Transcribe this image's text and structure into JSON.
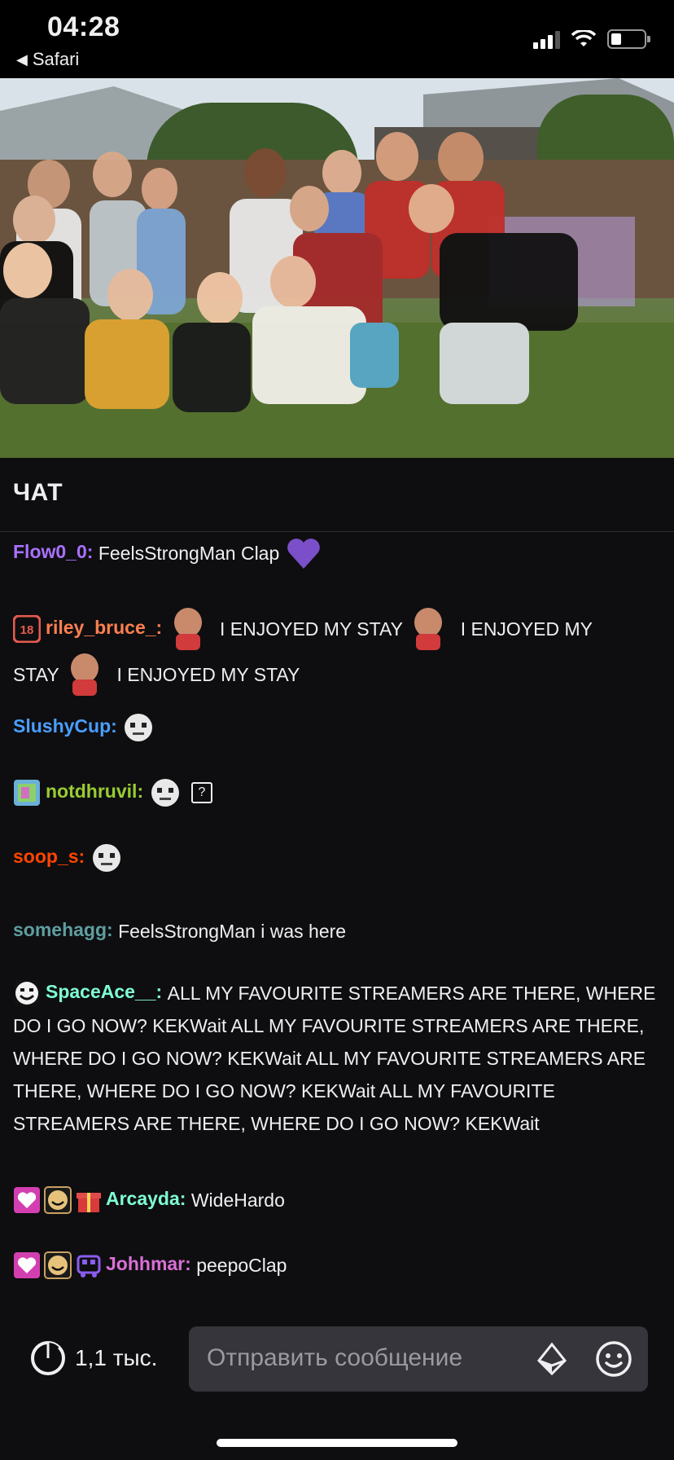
{
  "status_bar": {
    "time": "04:28",
    "back_app": "Safari"
  },
  "chat": {
    "title": "ЧАТ",
    "messages": [
      {
        "user": "Flow0_0",
        "user_color": "#a970ff",
        "text": "FeelsStrongMan Clap",
        "emotes": [
          "purple-heart-emote"
        ]
      },
      {
        "user": "riley_bruce_",
        "user_color": "#ff7f50",
        "badges": [
          "18-month-subscriber-badge"
        ],
        "parts": [
          "I ENJOYED MY STAY",
          "I ENJOYED MY",
          "STAY",
          "I ENJOYED MY STAY"
        ]
      },
      {
        "user": "SlushyCup",
        "user_color": "#4a9eff",
        "emotes": [
          "robot-face-emote"
        ]
      },
      {
        "user": "notdhruvil",
        "user_color": "#9acd32",
        "badges": [
          "pixel-art-badge"
        ],
        "emotes": [
          "robot-face-emote",
          "unknown-emote"
        ],
        "unknown_symbol": "?"
      },
      {
        "user": "soop_s",
        "user_color": "#ff4500",
        "emotes": [
          "robot-face-emote"
        ]
      },
      {
        "user": "somehagg",
        "user_color": "#5f9ea0",
        "text": "FeelsStrongMan i was here"
      },
      {
        "user": "SpaceAce__",
        "user_color": "#7fffd4",
        "badges": [
          "smile-face-badge"
        ],
        "text": "ALL MY FAVOURITE STREAMERS ARE THERE, WHERE DO I GO NOW? KEKWait ALL MY FAVOURITE STREAMERS ARE THERE, WHERE DO I GO NOW? KEKWait ALL MY FAVOURITE STREAMERS ARE THERE, WHERE DO I GO NOW? KEKWait ALL MY FAVOURITE STREAMERS ARE THERE, WHERE DO I GO NOW? KEKWait"
      },
      {
        "user": "Arcayda",
        "user_color": "#7fffd4",
        "badges": [
          "heart-subscriber-badge",
          "smile-face-badge",
          "gift-badge"
        ],
        "text": "WideHardo"
      },
      {
        "user": "Johhmar",
        "user_color": "#da70d6",
        "badges": [
          "heart-subscriber-badge",
          "smile-face-badge",
          "bus-badge"
        ],
        "text": "peepoClap"
      }
    ]
  },
  "input_bar": {
    "viewer_count": "1,1 тыс.",
    "placeholder": "Отправить сообщение"
  },
  "colors": {
    "background": "#0e0e10",
    "accent": "#9147ff",
    "input_bg": "#35353b"
  }
}
